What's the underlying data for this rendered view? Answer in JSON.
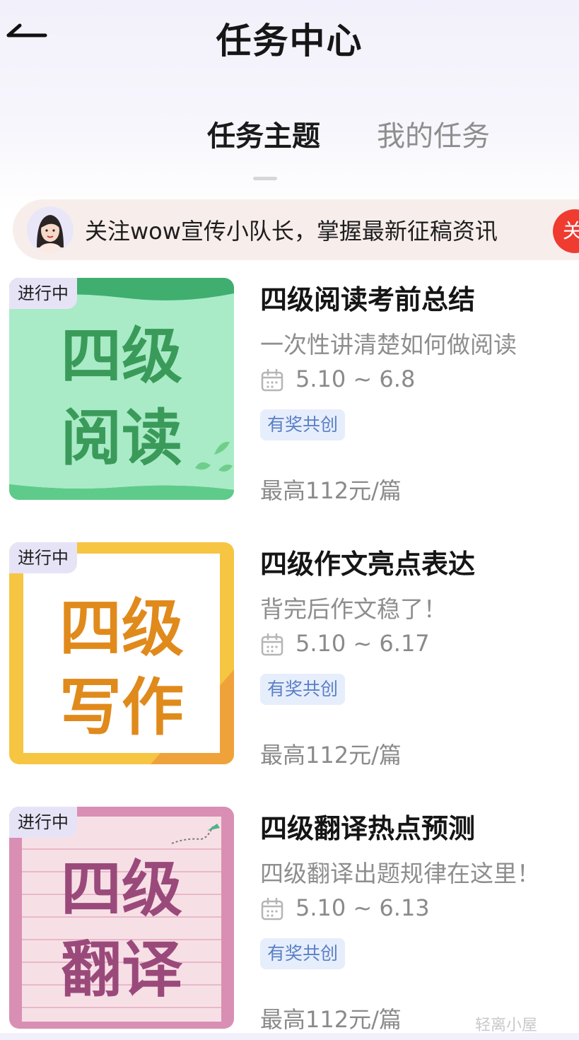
{
  "header": {
    "back_icon": "back-arrow-icon",
    "title": "任务中心"
  },
  "tabs": [
    {
      "label": "任务主题",
      "active": true
    },
    {
      "label": "我的任务",
      "active": false
    }
  ],
  "banner": {
    "text": "关注wow宣传小队长，掌握最新征稿资讯",
    "action_label": "关"
  },
  "tasks": [
    {
      "badge": "进行中",
      "cover_line1": "四级",
      "cover_line2": "阅读",
      "title": "四级阅读考前总结",
      "subtitle": "一次性讲清楚如何做阅读",
      "date": "5.10 ~ 6.8",
      "tag": "有奖共创",
      "reward": "最高112元/篇"
    },
    {
      "badge": "进行中",
      "cover_line1": "四级",
      "cover_line2": "写作",
      "title": "四级作文亮点表达",
      "subtitle": "背完后作文稳了！",
      "date": "5.10 ~ 6.17",
      "tag": "有奖共创",
      "reward": "最高112元/篇"
    },
    {
      "badge": "进行中",
      "cover_line1": "四级",
      "cover_line2": "翻译",
      "title": "四级翻译热点预测",
      "subtitle": "四级翻译出题规律在这里！",
      "date": "5.10 ~ 6.13",
      "tag": "有奖共创",
      "reward": "最高112元/篇"
    }
  ],
  "watermark": "轻离小屋",
  "colors": {
    "accent_red": "#ef3b30",
    "tag_blue": "#5b7fc5",
    "reading_green": "#3a9a5a",
    "writing_orange": "#e08a1c",
    "translation_purple": "#9a4a7a"
  }
}
